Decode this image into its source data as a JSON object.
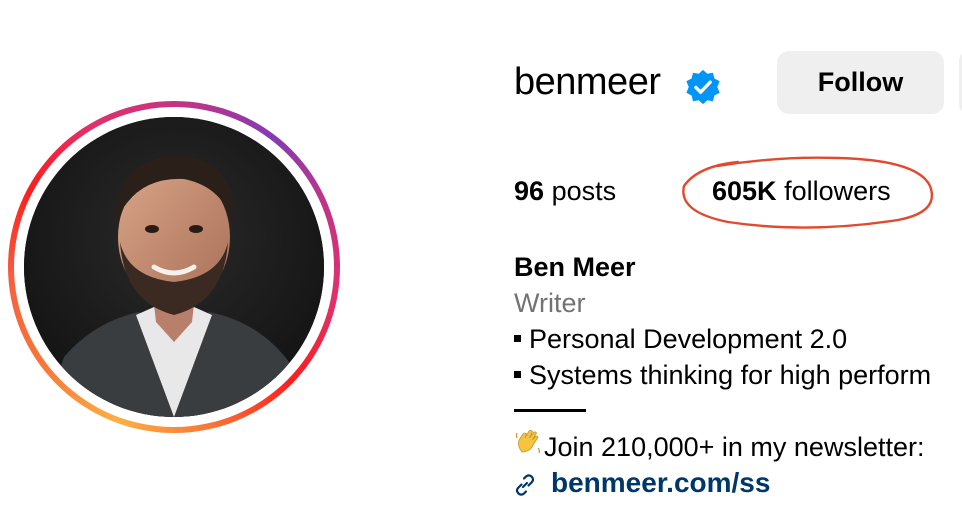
{
  "profile": {
    "username": "benmeer",
    "follow_label": "Follow",
    "stats": {
      "posts_count": "96",
      "posts_label": "posts",
      "followers_count": "605K",
      "followers_label": "followers"
    },
    "full_name": "Ben Meer",
    "category": "Writer",
    "bio_lines": [
      "Personal Development 2.0",
      "Systems thinking for high perform",
      "Join 210,000+ in my newsletter:"
    ],
    "link": "benmeer.com/ss"
  },
  "icons": {
    "verified": "verified-badge-icon",
    "link": "link-icon",
    "wave": "waving-hand-emoji"
  },
  "colors": {
    "verified_blue": "#0095f6",
    "link_blue": "#00376b",
    "button_gray": "#efefef",
    "annotation_red": "#e04a2f"
  }
}
